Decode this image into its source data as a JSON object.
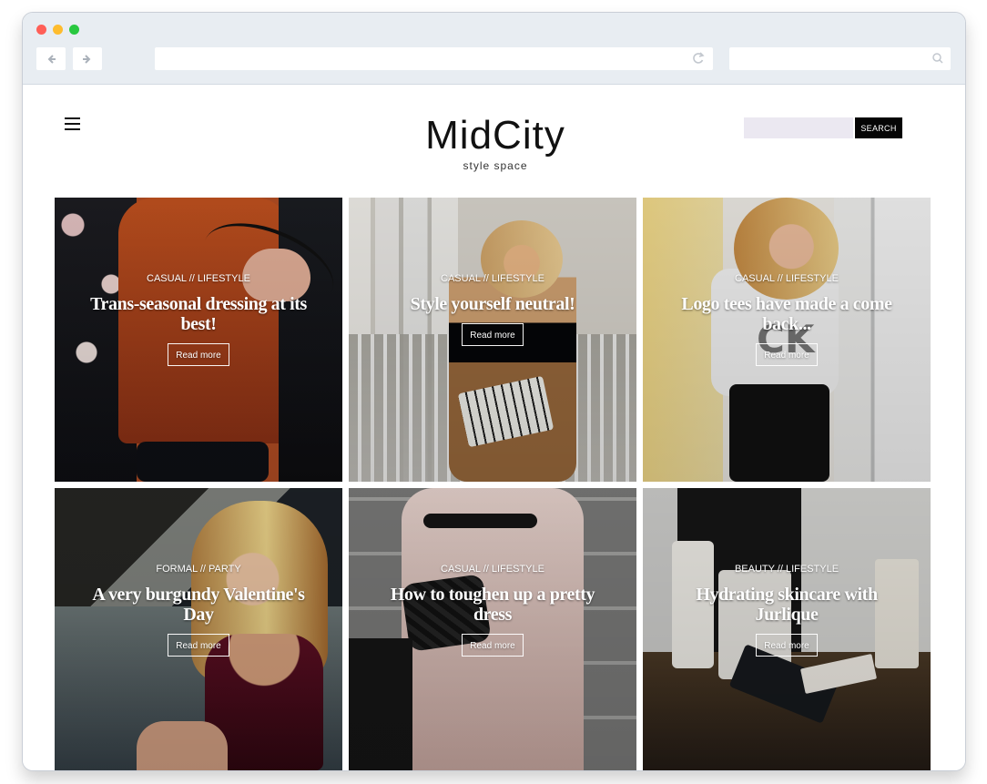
{
  "browser": {
    "address": "",
    "search_placeholder": ""
  },
  "site": {
    "brand": {
      "name": "MidCity",
      "tagline": "style space"
    },
    "search": {
      "placeholder": "",
      "button_label": "SEARCH"
    },
    "posts": [
      {
        "category": "CASUAL // LIFESTYLE",
        "title": "Trans-seasonal dressing at its best!",
        "cta": "Read more"
      },
      {
        "category": "CASUAL // LIFESTYLE",
        "title": "Style yourself neutral!",
        "cta": "Read more"
      },
      {
        "category": "CASUAL // LIFESTYLE",
        "title": "Logo tees have made a come back...",
        "cta": "Read more"
      },
      {
        "category": "FORMAL // PARTY",
        "title": "A very burgundy Valentine's Day",
        "cta": "Read more"
      },
      {
        "category": "CASUAL // LIFESTYLE",
        "title": "How to toughen up a pretty dress",
        "cta": "Read more"
      },
      {
        "category": "BEAUTY // LIFESTYLE",
        "title": "Hydrating skincare with Jurlique",
        "cta": "Read more"
      }
    ]
  },
  "icons": {
    "back": "left-arrow-icon",
    "forward": "right-arrow-icon",
    "reload": "reload-icon",
    "search": "search-icon",
    "menu": "hamburger-menu-icon"
  },
  "colors": {
    "chrome": "#e8edf2",
    "search_field": "#ebe8f1",
    "search_button": "#050505",
    "text_dark": "#111111",
    "text_light": "#ffffff"
  }
}
